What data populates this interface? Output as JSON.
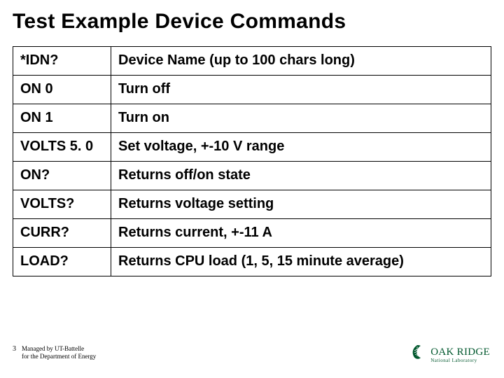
{
  "title": "Test Example Device Commands",
  "table": {
    "rows": [
      {
        "cmd": "*IDN?",
        "desc": "Device Name (up to 100 chars long)"
      },
      {
        "cmd": "ON 0",
        "desc": "Turn off"
      },
      {
        "cmd": "ON 1",
        "desc": "Turn on"
      },
      {
        "cmd": "VOLTS 5. 0",
        "desc": "Set voltage, +-10 V range"
      },
      {
        "cmd": "ON?",
        "desc": "Returns off/on state"
      },
      {
        "cmd": "VOLTS?",
        "desc": "Returns voltage setting"
      },
      {
        "cmd": "CURR?",
        "desc": "Returns current, +-11 A"
      },
      {
        "cmd": "LOAD?",
        "desc": "Returns CPU load (1, 5, 15 minute average)"
      }
    ]
  },
  "footer": {
    "page": "3",
    "line1": "Managed by UT-Battelle",
    "line2": "for the Department of Energy"
  },
  "logo": {
    "main": "OAK RIDGE",
    "sub": "National Laboratory"
  }
}
